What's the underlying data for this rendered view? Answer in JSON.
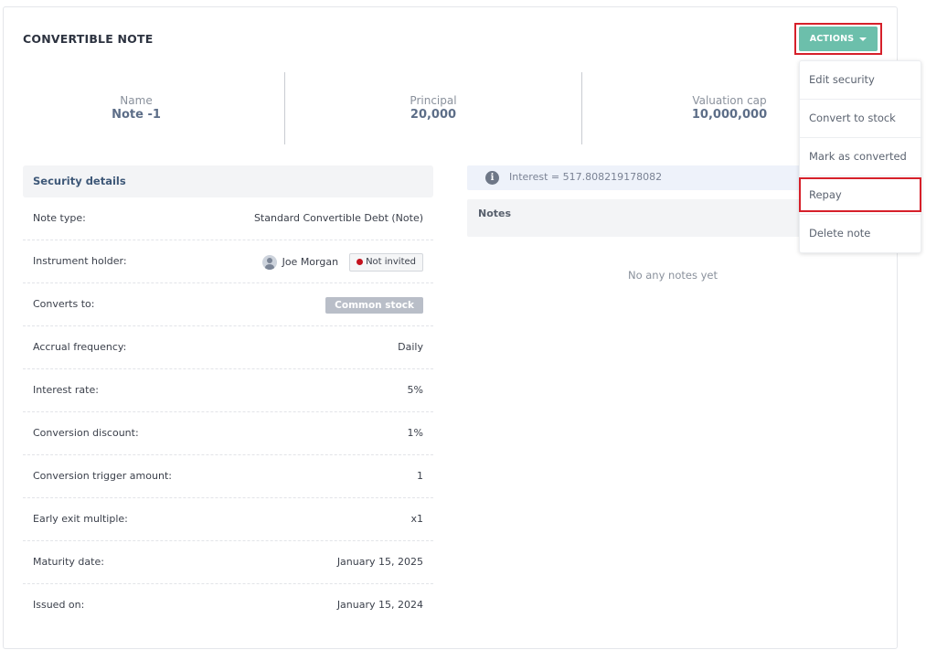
{
  "header": {
    "title": "CONVERTIBLE NOTE",
    "actions_label": "ACTIONS"
  },
  "summary": [
    {
      "label": "Name",
      "value": "Note -1"
    },
    {
      "label": "Principal",
      "value": "20,000"
    },
    {
      "label": "Valuation cap",
      "value": "10,000,000"
    }
  ],
  "security_details": {
    "heading": "Security details",
    "rows": [
      {
        "label": "Note type:",
        "value": "Standard Convertible Debt (Note)"
      },
      {
        "label": "Instrument holder:",
        "holder_name": "Joe Morgan",
        "status_badge": "Not invited"
      },
      {
        "label": "Converts to:",
        "value": "Common stock"
      },
      {
        "label": "Accrual frequency:",
        "value": "Daily"
      },
      {
        "label": "Interest rate:",
        "value": "5%"
      },
      {
        "label": "Conversion discount:",
        "value": "1%"
      },
      {
        "label": "Conversion trigger amount:",
        "value": "1"
      },
      {
        "label": "Early exit multiple:",
        "value": "x1"
      },
      {
        "label": "Maturity date:",
        "value": "January 15, 2025"
      },
      {
        "label": "Issued on:",
        "value": "January 15, 2024"
      }
    ]
  },
  "interest": {
    "text": "Interest = 517.808219178082",
    "icon": "info-icon"
  },
  "notes": {
    "heading": "Notes",
    "empty_text": "No any notes yet"
  },
  "actions_menu": {
    "items": [
      {
        "label": "Edit security"
      },
      {
        "label": "Convert to stock"
      },
      {
        "label": "Mark as converted"
      },
      {
        "label": "Repay"
      },
      {
        "label": "Delete note"
      }
    ]
  },
  "colors": {
    "accent": "#6cbfab",
    "highlight_outline": "#d6202a",
    "status_not_invited": "#c4121d"
  }
}
